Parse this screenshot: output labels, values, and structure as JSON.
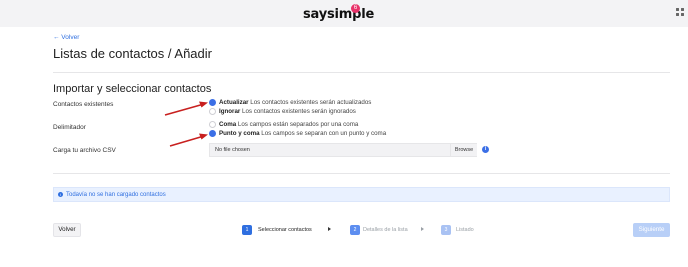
{
  "header": {
    "brand": "saysimple",
    "badge": "6",
    "apps_icon": "grid-icon"
  },
  "page": {
    "back_link": "← Volver",
    "title": "Listas de contactos / Añadir"
  },
  "form": {
    "section_title": "Importar y seleccionar contactos",
    "existing_contacts": {
      "label": "Contactos existentes",
      "options": [
        {
          "strong": "Actualizar",
          "text": " Los contactos existentes serán actualizados",
          "selected": true
        },
        {
          "strong": "Ignorar",
          "text": " Los contactos existentes serán ignorados",
          "selected": false
        }
      ]
    },
    "delimiter": {
      "label": "Delimitador",
      "options": [
        {
          "strong": "Coma",
          "text": " Los campos están separados por una coma",
          "selected": false
        },
        {
          "strong": "Punto y coma",
          "text": " Los campos se separan con un punto y coma",
          "selected": true
        }
      ]
    },
    "csv": {
      "label": "Carga tu archivo CSV",
      "file_text": "No file chosen",
      "browse_label": "Browse",
      "info_icon": "info-icon"
    }
  },
  "alert": {
    "text": "Todavía no se han cargado contactos",
    "icon": "info-icon"
  },
  "footer": {
    "back_label": "Volver",
    "steps": [
      {
        "num": "1",
        "label": "Seleccionar contactos"
      },
      {
        "num": "2",
        "label": "Detalles de la lista"
      },
      {
        "num": "3",
        "label": "Listado"
      }
    ],
    "next_label": "Siguiente"
  },
  "colors": {
    "accent": "#2f6fe0",
    "brand_badge": "#e8336a",
    "annotation_arrow": "#c8201f",
    "disabled_button": "#b8cff7"
  }
}
